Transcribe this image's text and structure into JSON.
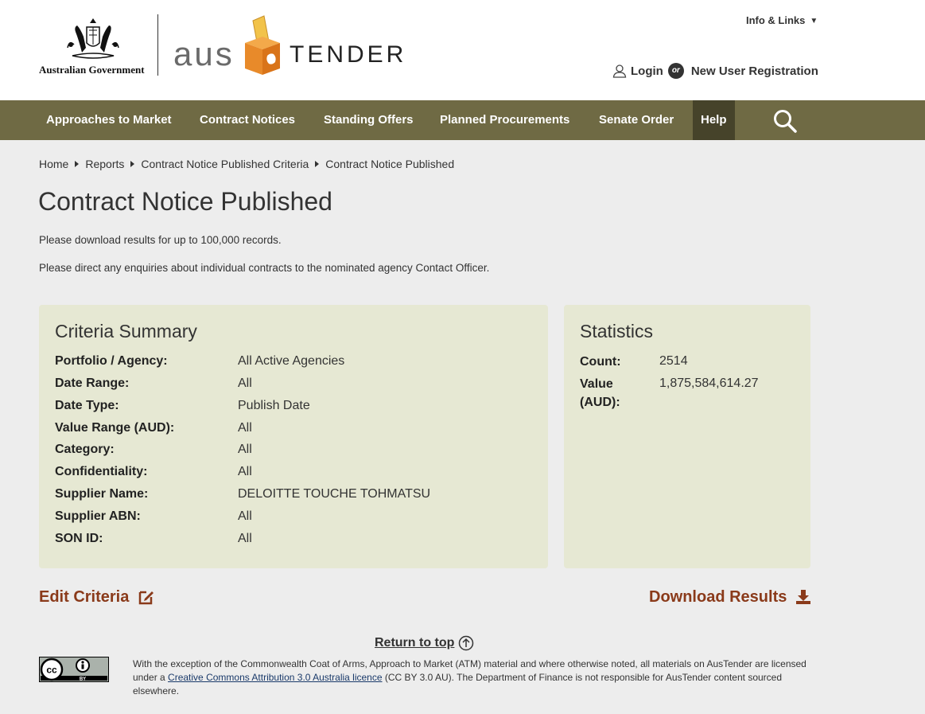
{
  "header": {
    "gov_text": "Australian Government",
    "aus_text": "aus",
    "tender_text": "TENDER",
    "info_links": "Info & Links",
    "login": "Login",
    "or": "or",
    "new_user": "New User Registration"
  },
  "nav": {
    "items": [
      {
        "label": "Approaches to Market"
      },
      {
        "label": "Contract Notices"
      },
      {
        "label": "Standing Offers"
      },
      {
        "label": "Planned Procurements"
      },
      {
        "label": "Senate Order"
      },
      {
        "label": "Help"
      }
    ]
  },
  "breadcrumb": [
    "Home",
    "Reports",
    "Contract Notice Published Criteria",
    "Contract Notice Published"
  ],
  "page_title": "Contract Notice Published",
  "intro": [
    "Please download results for up to 100,000 records.",
    "Please direct any enquiries about individual contracts to the nominated agency Contact Officer."
  ],
  "criteria": {
    "title": "Criteria Summary",
    "rows": [
      {
        "label": "Portfolio / Agency:",
        "value": "All Active Agencies"
      },
      {
        "label": "Date Range:",
        "value": "All"
      },
      {
        "label": "Date Type:",
        "value": "Publish Date"
      },
      {
        "label": "Value Range (AUD):",
        "value": "All"
      },
      {
        "label": "Category:",
        "value": "All"
      },
      {
        "label": "Confidentiality:",
        "value": "All"
      },
      {
        "label": "Supplier Name:",
        "value": "DELOITTE TOUCHE TOHMATSU"
      },
      {
        "label": "Supplier ABN:",
        "value": "All"
      },
      {
        "label": "SON ID:",
        "value": "All"
      }
    ]
  },
  "statistics": {
    "title": "Statistics",
    "count_label": "Count:",
    "count_value": "2514",
    "value_label_1": "Value",
    "value_label_2": "(AUD):",
    "value_value": "1,875,584,614.27"
  },
  "actions": {
    "edit": "Edit Criteria",
    "download": "Download Results"
  },
  "footer": {
    "return_top": "Return to top",
    "cc_label": "BY",
    "license_before": "With the exception of the Commonwealth Coat of Arms, Approach to Market (ATM) material and where otherwise noted, all materials on AusTender are licensed under a ",
    "license_link": "Creative Commons Attribution 3.0 Australia licence",
    "license_after": " (CC BY 3.0 AU). The Department of Finance is not responsible for AusTender content sourced elsewhere."
  },
  "colors": {
    "nav_bg": "#6f6a44",
    "nav_active": "#46432a",
    "panel_bg": "#e6e8d3",
    "action_link": "#8a3a1a",
    "page_bg": "#ededed"
  }
}
